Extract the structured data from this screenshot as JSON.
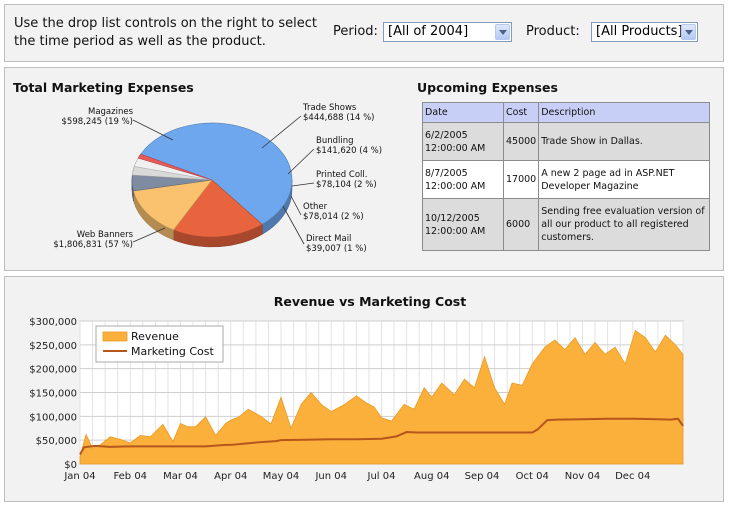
{
  "controls": {
    "instructions": "Use the drop list controls on the right to select the time period as well as the product.",
    "period_label": "Period:",
    "period_value": "[All of 2004]",
    "product_label": "Product:",
    "product_value": "[All Products]"
  },
  "marketing": {
    "title": "Total Marketing Expenses"
  },
  "pie_chart_data": {
    "type": "pie",
    "slices": [
      {
        "name": "Web Banners",
        "amount": "$1,806,831",
        "pct": "(57 %)",
        "value": 1806831,
        "color": "#6fa7ef"
      },
      {
        "name": "Magazines",
        "amount": "$598,245",
        "pct": "(19 %)",
        "value": 598245,
        "color": "#e8643f"
      },
      {
        "name": "Trade Shows",
        "amount": "$444,688",
        "pct": "(14 %)",
        "value": 444688,
        "color": "#fac16f"
      },
      {
        "name": "Bundling",
        "amount": "$141,620",
        "pct": "(4 %)",
        "value": 141620,
        "color": "#7f8ba0"
      },
      {
        "name": "Printed Coll.",
        "amount": "$78,104",
        "pct": "(2 %)",
        "value": 78104,
        "color": "#d9d9d9"
      },
      {
        "name": "Other",
        "amount": "$78,014",
        "pct": "(2 %)",
        "value": 78014,
        "color": "#f0f0f0"
      },
      {
        "name": "Direct Mail",
        "amount": "$39,007",
        "pct": "(1 %)",
        "value": 39007,
        "color": "#e85a5a"
      }
    ]
  },
  "expenses": {
    "title": "Upcoming Expenses",
    "headers": [
      "Date",
      "Cost",
      "Description"
    ],
    "rows": [
      {
        "date_line1": "6/2/2005",
        "date_line2": "12:00:00 AM",
        "cost": "45000",
        "description": "Trade Show in Dallas."
      },
      {
        "date_line1": "8/7/2005",
        "date_line2": "12:00:00 AM",
        "cost": "17000",
        "description": "A new 2 page ad in ASP.NET Developer Magazine"
      },
      {
        "date_line1": "10/12/2005",
        "date_line2": "12:00:00 AM",
        "cost": "6000",
        "description": "Sending free evaluation version of all our product to all registered customers."
      }
    ]
  },
  "chart_data": {
    "type": "area",
    "title": "Revenue vs Marketing Cost",
    "x_tick_labels": [
      "Jan 04",
      "Feb 04",
      "Mar 04",
      "Apr 04",
      "May 04",
      "Jun 04",
      "Jul 04",
      "Aug 04",
      "Sep 04",
      "Oct 04",
      "Nov 04",
      "Dec 04"
    ],
    "y_tick_labels": [
      "$0",
      "$50,000",
      "$100,000",
      "$150,000",
      "$200,000",
      "$250,000",
      "$300,000"
    ],
    "ylim": [
      0,
      300000
    ],
    "x_range": [
      0,
      12
    ],
    "grid": true,
    "legend_position": "top-left",
    "series": [
      {
        "name": "Revenue",
        "color": "#fbb03b",
        "x": [
          0,
          0.12,
          0.25,
          0.4,
          0.6,
          0.8,
          1.0,
          1.2,
          1.4,
          1.65,
          1.85,
          2.0,
          2.15,
          2.3,
          2.5,
          2.7,
          2.9,
          3.0,
          3.15,
          3.35,
          3.6,
          3.8,
          4.0,
          4.2,
          4.4,
          4.6,
          4.8,
          5.0,
          5.25,
          5.5,
          5.7,
          5.85,
          6.0,
          6.2,
          6.45,
          6.65,
          6.85,
          7.0,
          7.2,
          7.45,
          7.65,
          7.85,
          8.05,
          8.25,
          8.45,
          8.6,
          8.8,
          9.0,
          9.25,
          9.45,
          9.65,
          9.85,
          10.05,
          10.25,
          10.45,
          10.65,
          10.85,
          11.05,
          11.25,
          11.45,
          11.65,
          11.85,
          12.0
        ],
        "values": [
          15000,
          62000,
          33000,
          40000,
          57000,
          52000,
          44000,
          60000,
          57000,
          83000,
          47000,
          85000,
          78000,
          78000,
          99000,
          60000,
          85000,
          92000,
          98000,
          115000,
          100000,
          84000,
          140000,
          75000,
          125000,
          150000,
          125000,
          110000,
          124000,
          143000,
          128000,
          120000,
          97000,
          90000,
          125000,
          115000,
          160000,
          140000,
          170000,
          145000,
          178000,
          160000,
          225000,
          160000,
          125000,
          170000,
          165000,
          210000,
          245000,
          260000,
          240000,
          265000,
          230000,
          255000,
          230000,
          245000,
          210000,
          280000,
          265000,
          235000,
          270000,
          250000,
          230000
        ]
      },
      {
        "name": "Marketing Cost",
        "color": "#b5561c",
        "x": [
          0,
          0.08,
          0.3,
          0.6,
          1,
          1.5,
          2,
          2.5,
          2.9,
          3.0,
          3.3,
          3.6,
          3.9,
          4.0,
          4.5,
          5.0,
          5.5,
          6.0,
          6.3,
          6.5,
          6.7,
          7,
          7.5,
          8,
          8.5,
          9.0,
          9.1,
          9.3,
          9.5,
          10,
          10.5,
          11,
          11.5,
          11.75,
          11.9,
          12.0
        ],
        "values": [
          20000,
          35000,
          38000,
          36000,
          37000,
          37000,
          37000,
          37000,
          40000,
          40000,
          43000,
          46000,
          48000,
          50000,
          51000,
          52000,
          52000,
          53000,
          58000,
          67000,
          66000,
          66000,
          66000,
          66000,
          66000,
          66000,
          72000,
          92000,
          93000,
          94000,
          95000,
          95000,
          94000,
          93000,
          95000,
          80000
        ]
      }
    ]
  }
}
